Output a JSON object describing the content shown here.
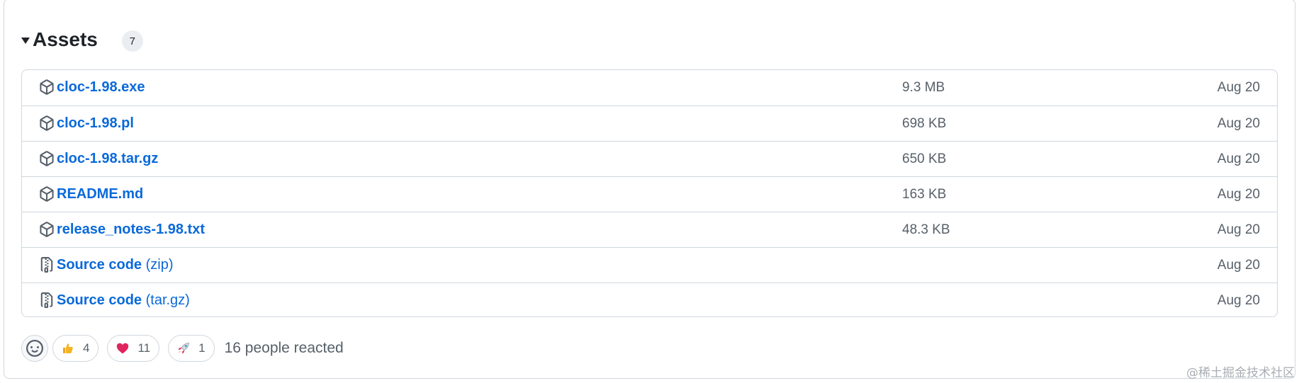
{
  "assets": {
    "title": "Assets",
    "count": "7",
    "items": [
      {
        "name": "cloc-1.98.exe",
        "suffix": "",
        "size": "9.3 MB",
        "date": "Aug 20",
        "icon": "package-icon"
      },
      {
        "name": "cloc-1.98.pl",
        "suffix": "",
        "size": "698 KB",
        "date": "Aug 20",
        "icon": "package-icon"
      },
      {
        "name": "cloc-1.98.tar.gz",
        "suffix": "",
        "size": "650 KB",
        "date": "Aug 20",
        "icon": "package-icon"
      },
      {
        "name": "README.md",
        "suffix": "",
        "size": "163 KB",
        "date": "Aug 20",
        "icon": "package-icon"
      },
      {
        "name": "release_notes-1.98.txt",
        "suffix": "",
        "size": "48.3 KB",
        "date": "Aug 20",
        "icon": "package-icon"
      },
      {
        "name": "Source code",
        "suffix": " (zip)",
        "size": "",
        "date": "Aug 20",
        "icon": "file-zip-icon"
      },
      {
        "name": "Source code",
        "suffix": " (tar.gz)",
        "size": "",
        "date": "Aug 20",
        "icon": "file-zip-icon"
      }
    ]
  },
  "reactions": {
    "items": [
      {
        "emoji": "thumbs-up-icon",
        "count": "4"
      },
      {
        "emoji": "heart-icon",
        "count": "11"
      },
      {
        "emoji": "rocket-icon",
        "count": "1"
      }
    ],
    "summary": "16 people reacted"
  },
  "watermark": "@稀土掘金技术社区",
  "colors": {
    "link": "#0969da",
    "muted": "#57606a",
    "border": "#d0d7de"
  }
}
